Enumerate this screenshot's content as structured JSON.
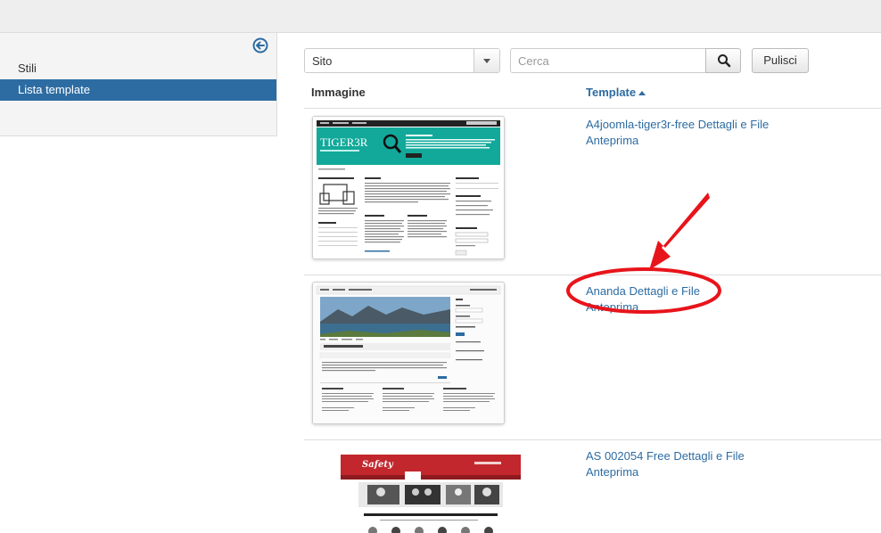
{
  "sidebar": {
    "items": [
      {
        "label": "Stili",
        "active": false
      },
      {
        "label": "Lista template",
        "active": true
      }
    ]
  },
  "filters": {
    "client_select": "Sito",
    "search_placeholder": "Cerca",
    "clear_label": "Pulisci"
  },
  "table": {
    "headers": {
      "image": "Immagine",
      "template": "Template"
    },
    "rows": [
      {
        "name": "A4joomla-tiger3r-free",
        "details": "Dettagli e File",
        "preview": "Anteprima"
      },
      {
        "name": "Ananda",
        "details": "Dettagli e File",
        "preview": "Anteprima"
      },
      {
        "name": "AS 002054 Free",
        "details": "Dettagli e File",
        "preview": "Anteprima"
      }
    ]
  },
  "colors": {
    "accent": "#2d6ca2",
    "annotation": "#e8141b",
    "tiger_teal": "#12a99a",
    "safety_red": "#c2272d"
  }
}
